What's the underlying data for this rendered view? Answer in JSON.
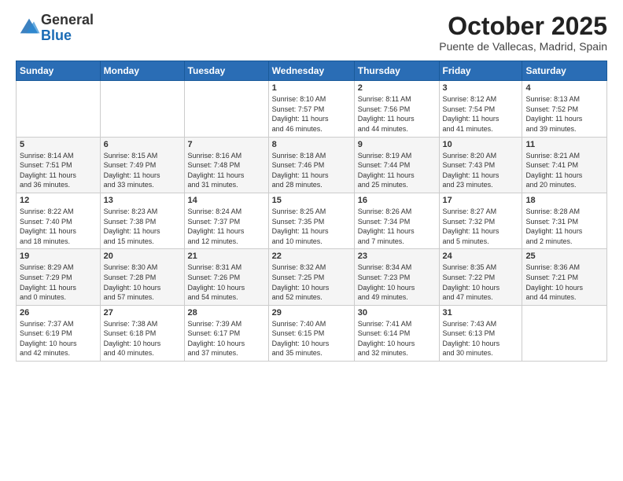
{
  "logo": {
    "general": "General",
    "blue": "Blue"
  },
  "header": {
    "month": "October 2025",
    "location": "Puente de Vallecas, Madrid, Spain"
  },
  "weekdays": [
    "Sunday",
    "Monday",
    "Tuesday",
    "Wednesday",
    "Thursday",
    "Friday",
    "Saturday"
  ],
  "weeks": [
    [
      {
        "day": "",
        "info": ""
      },
      {
        "day": "",
        "info": ""
      },
      {
        "day": "",
        "info": ""
      },
      {
        "day": "1",
        "info": "Sunrise: 8:10 AM\nSunset: 7:57 PM\nDaylight: 11 hours\nand 46 minutes."
      },
      {
        "day": "2",
        "info": "Sunrise: 8:11 AM\nSunset: 7:56 PM\nDaylight: 11 hours\nand 44 minutes."
      },
      {
        "day": "3",
        "info": "Sunrise: 8:12 AM\nSunset: 7:54 PM\nDaylight: 11 hours\nand 41 minutes."
      },
      {
        "day": "4",
        "info": "Sunrise: 8:13 AM\nSunset: 7:52 PM\nDaylight: 11 hours\nand 39 minutes."
      }
    ],
    [
      {
        "day": "5",
        "info": "Sunrise: 8:14 AM\nSunset: 7:51 PM\nDaylight: 11 hours\nand 36 minutes."
      },
      {
        "day": "6",
        "info": "Sunrise: 8:15 AM\nSunset: 7:49 PM\nDaylight: 11 hours\nand 33 minutes."
      },
      {
        "day": "7",
        "info": "Sunrise: 8:16 AM\nSunset: 7:48 PM\nDaylight: 11 hours\nand 31 minutes."
      },
      {
        "day": "8",
        "info": "Sunrise: 8:18 AM\nSunset: 7:46 PM\nDaylight: 11 hours\nand 28 minutes."
      },
      {
        "day": "9",
        "info": "Sunrise: 8:19 AM\nSunset: 7:44 PM\nDaylight: 11 hours\nand 25 minutes."
      },
      {
        "day": "10",
        "info": "Sunrise: 8:20 AM\nSunset: 7:43 PM\nDaylight: 11 hours\nand 23 minutes."
      },
      {
        "day": "11",
        "info": "Sunrise: 8:21 AM\nSunset: 7:41 PM\nDaylight: 11 hours\nand 20 minutes."
      }
    ],
    [
      {
        "day": "12",
        "info": "Sunrise: 8:22 AM\nSunset: 7:40 PM\nDaylight: 11 hours\nand 18 minutes."
      },
      {
        "day": "13",
        "info": "Sunrise: 8:23 AM\nSunset: 7:38 PM\nDaylight: 11 hours\nand 15 minutes."
      },
      {
        "day": "14",
        "info": "Sunrise: 8:24 AM\nSunset: 7:37 PM\nDaylight: 11 hours\nand 12 minutes."
      },
      {
        "day": "15",
        "info": "Sunrise: 8:25 AM\nSunset: 7:35 PM\nDaylight: 11 hours\nand 10 minutes."
      },
      {
        "day": "16",
        "info": "Sunrise: 8:26 AM\nSunset: 7:34 PM\nDaylight: 11 hours\nand 7 minutes."
      },
      {
        "day": "17",
        "info": "Sunrise: 8:27 AM\nSunset: 7:32 PM\nDaylight: 11 hours\nand 5 minutes."
      },
      {
        "day": "18",
        "info": "Sunrise: 8:28 AM\nSunset: 7:31 PM\nDaylight: 11 hours\nand 2 minutes."
      }
    ],
    [
      {
        "day": "19",
        "info": "Sunrise: 8:29 AM\nSunset: 7:29 PM\nDaylight: 11 hours\nand 0 minutes."
      },
      {
        "day": "20",
        "info": "Sunrise: 8:30 AM\nSunset: 7:28 PM\nDaylight: 10 hours\nand 57 minutes."
      },
      {
        "day": "21",
        "info": "Sunrise: 8:31 AM\nSunset: 7:26 PM\nDaylight: 10 hours\nand 54 minutes."
      },
      {
        "day": "22",
        "info": "Sunrise: 8:32 AM\nSunset: 7:25 PM\nDaylight: 10 hours\nand 52 minutes."
      },
      {
        "day": "23",
        "info": "Sunrise: 8:34 AM\nSunset: 7:23 PM\nDaylight: 10 hours\nand 49 minutes."
      },
      {
        "day": "24",
        "info": "Sunrise: 8:35 AM\nSunset: 7:22 PM\nDaylight: 10 hours\nand 47 minutes."
      },
      {
        "day": "25",
        "info": "Sunrise: 8:36 AM\nSunset: 7:21 PM\nDaylight: 10 hours\nand 44 minutes."
      }
    ],
    [
      {
        "day": "26",
        "info": "Sunrise: 7:37 AM\nSunset: 6:19 PM\nDaylight: 10 hours\nand 42 minutes."
      },
      {
        "day": "27",
        "info": "Sunrise: 7:38 AM\nSunset: 6:18 PM\nDaylight: 10 hours\nand 40 minutes."
      },
      {
        "day": "28",
        "info": "Sunrise: 7:39 AM\nSunset: 6:17 PM\nDaylight: 10 hours\nand 37 minutes."
      },
      {
        "day": "29",
        "info": "Sunrise: 7:40 AM\nSunset: 6:15 PM\nDaylight: 10 hours\nand 35 minutes."
      },
      {
        "day": "30",
        "info": "Sunrise: 7:41 AM\nSunset: 6:14 PM\nDaylight: 10 hours\nand 32 minutes."
      },
      {
        "day": "31",
        "info": "Sunrise: 7:43 AM\nSunset: 6:13 PM\nDaylight: 10 hours\nand 30 minutes."
      },
      {
        "day": "",
        "info": ""
      }
    ]
  ]
}
